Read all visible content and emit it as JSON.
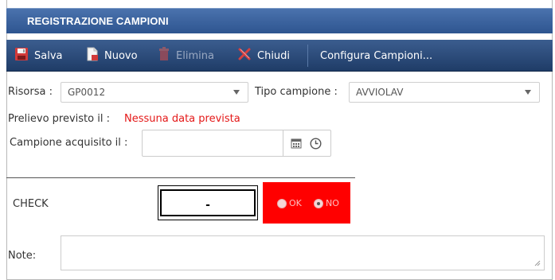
{
  "window": {
    "title": "REGISTRAZIONE CAMPIONI"
  },
  "toolbar": {
    "save_label": "Salva",
    "new_label": "Nuovo",
    "delete_label": "Elimina",
    "close_label": "Chiudi",
    "configure_label": "Configura Campioni..."
  },
  "form": {
    "resource_label": "Risorsa :",
    "resource_value": "GP0012",
    "sample_type_label": "Tipo campione :",
    "sample_type_value": "AVVIOLAV",
    "planned_label": "Prelievo previsto il :",
    "planned_value": "Nessuna data prevista",
    "acquired_label": "Campione acquisito il :",
    "acquired_value": "",
    "check_label": "CHECK",
    "check_value": "-",
    "radio_ok_label": "OK",
    "radio_no_label": "NO",
    "radio_selected": "NO",
    "note_label": "Note:",
    "note_value": ""
  },
  "colors": {
    "title_bar": "#3d66a3",
    "toolbar": "#2a4a7a",
    "status_red": "#e41818",
    "check_panel": "#ff0000"
  },
  "icons": [
    "save-icon",
    "new-document-icon",
    "delete-icon",
    "close-icon",
    "calendar-icon",
    "clock-icon"
  ]
}
